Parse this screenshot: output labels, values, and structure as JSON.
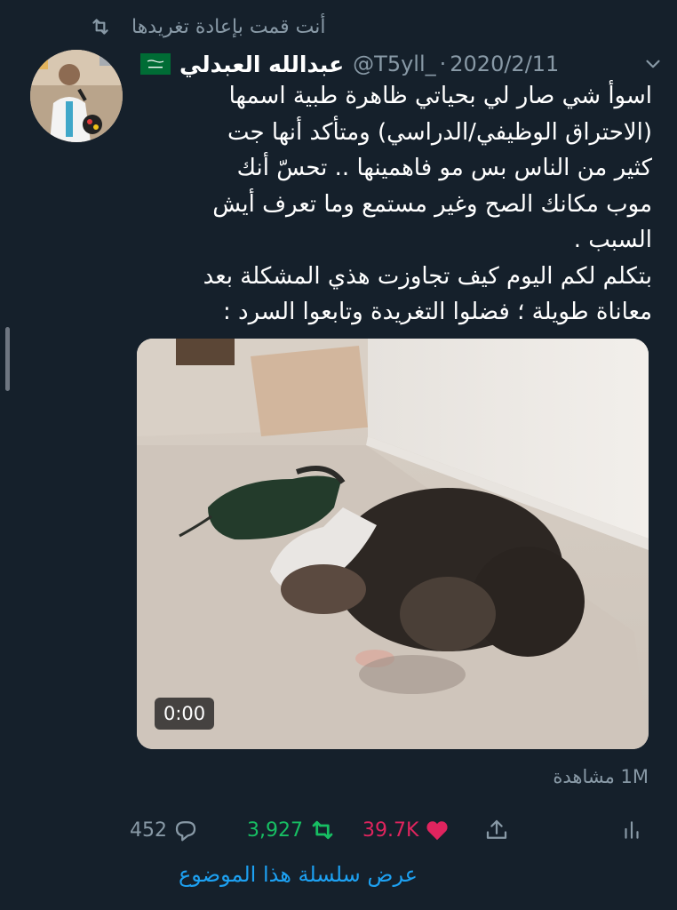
{
  "retweet_header": {
    "text": "أنت قمت بإعادة تغريدها",
    "icon": "retweet-icon"
  },
  "author": {
    "display_name": "عبدالله العبدلي",
    "flag": "saudi-flag-icon",
    "handle": "@T5yll_",
    "separator": "·",
    "date": "2020/2/11"
  },
  "tweet": {
    "lines": [
      "اسوأ شي صار لي بحياتي ظاهرة طبية اسمها",
      "(الاحتراق الوظيفي/الدراسي) ومتأكد أنها جت",
      "كثير من الناس بس مو فاهمينها .. تحسّ أنك",
      "موب مكانك الصح وغير مستمع وما تعرف أيش",
      "السبب .",
      "بتكلم لكم اليوم كيف تجاوزت هذي المشكلة بعد",
      "معاناة طويلة ؛ فضلوا التغريدة وتابعوا السرد :"
    ]
  },
  "media": {
    "duration": "0:00",
    "views": "1M مشاهدة"
  },
  "actions": {
    "replies": "452",
    "retweets": "3,927",
    "likes": "39.7K"
  },
  "colors": {
    "background": "#15202b",
    "muted": "#8899a6",
    "retweet_green": "#17bf63",
    "like_red": "#e0245e",
    "link_blue": "#1da1f2"
  },
  "thread_link": "عرض سلسلة هذا الموضوع"
}
